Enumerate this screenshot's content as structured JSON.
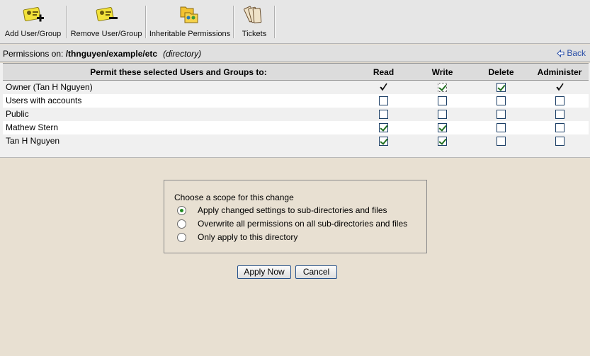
{
  "toolbar": {
    "items": [
      {
        "label": "Add User/Group",
        "icon": "add-user-icon"
      },
      {
        "label": "Remove User/Group",
        "icon": "remove-user-icon"
      },
      {
        "label": "Inheritable Permissions",
        "icon": "folders-users-icon"
      },
      {
        "label": "Tickets",
        "icon": "tickets-icon"
      }
    ]
  },
  "pathbar": {
    "prefix": "Permissions on: ",
    "path": "/thnguyen/example/etc",
    "type": "(directory)",
    "back_label": "Back"
  },
  "table": {
    "headers": [
      "Permit these selected Users and Groups to:",
      "Read",
      "Write",
      "Delete",
      "Administer"
    ],
    "rows": [
      {
        "name": "Owner (Tan H Nguyen)",
        "read": "locked",
        "write": "checked",
        "delete": "checked",
        "administer": "locked"
      },
      {
        "name": "Users with accounts",
        "read": "unchecked",
        "write": "unchecked",
        "delete": "unchecked",
        "administer": "unchecked"
      },
      {
        "name": "Public",
        "read": "unchecked",
        "write": "unchecked",
        "delete": "unchecked",
        "administer": "unchecked"
      },
      {
        "name": "Mathew Stern",
        "read": "checked",
        "write": "checked",
        "delete": "unchecked",
        "administer": "unchecked"
      },
      {
        "name": "Tan H Nguyen",
        "read": "checked",
        "write": "checked",
        "delete": "unchecked",
        "administer": "unchecked"
      }
    ]
  },
  "scope": {
    "title": "Choose a scope for this change",
    "options": [
      {
        "label": "Apply changed settings to sub-directories and files",
        "selected": true
      },
      {
        "label": "Overwrite all permissions on all sub-directories and files",
        "selected": false
      },
      {
        "label": "Only apply to this directory",
        "selected": false
      }
    ]
  },
  "buttons": {
    "apply": "Apply Now",
    "cancel": "Cancel"
  },
  "colors": {
    "background": "#e8e0d2",
    "toolbar": "#e6e6e6",
    "link": "#2a4fa8",
    "check": "#1f6e1f"
  }
}
